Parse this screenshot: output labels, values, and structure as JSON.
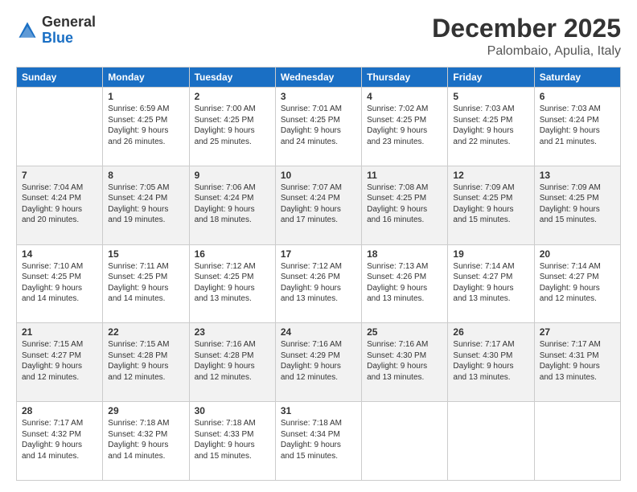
{
  "header": {
    "logo_general": "General",
    "logo_blue": "Blue",
    "month_title": "December 2025",
    "location": "Palombaio, Apulia, Italy"
  },
  "weekdays": [
    "Sunday",
    "Monday",
    "Tuesday",
    "Wednesday",
    "Thursday",
    "Friday",
    "Saturday"
  ],
  "weeks": [
    [
      {
        "day": "",
        "info": ""
      },
      {
        "day": "1",
        "info": "Sunrise: 6:59 AM\nSunset: 4:25 PM\nDaylight: 9 hours\nand 26 minutes."
      },
      {
        "day": "2",
        "info": "Sunrise: 7:00 AM\nSunset: 4:25 PM\nDaylight: 9 hours\nand 25 minutes."
      },
      {
        "day": "3",
        "info": "Sunrise: 7:01 AM\nSunset: 4:25 PM\nDaylight: 9 hours\nand 24 minutes."
      },
      {
        "day": "4",
        "info": "Sunrise: 7:02 AM\nSunset: 4:25 PM\nDaylight: 9 hours\nand 23 minutes."
      },
      {
        "day": "5",
        "info": "Sunrise: 7:03 AM\nSunset: 4:25 PM\nDaylight: 9 hours\nand 22 minutes."
      },
      {
        "day": "6",
        "info": "Sunrise: 7:03 AM\nSunset: 4:24 PM\nDaylight: 9 hours\nand 21 minutes."
      }
    ],
    [
      {
        "day": "7",
        "info": "Sunrise: 7:04 AM\nSunset: 4:24 PM\nDaylight: 9 hours\nand 20 minutes."
      },
      {
        "day": "8",
        "info": "Sunrise: 7:05 AM\nSunset: 4:24 PM\nDaylight: 9 hours\nand 19 minutes."
      },
      {
        "day": "9",
        "info": "Sunrise: 7:06 AM\nSunset: 4:24 PM\nDaylight: 9 hours\nand 18 minutes."
      },
      {
        "day": "10",
        "info": "Sunrise: 7:07 AM\nSunset: 4:24 PM\nDaylight: 9 hours\nand 17 minutes."
      },
      {
        "day": "11",
        "info": "Sunrise: 7:08 AM\nSunset: 4:25 PM\nDaylight: 9 hours\nand 16 minutes."
      },
      {
        "day": "12",
        "info": "Sunrise: 7:09 AM\nSunset: 4:25 PM\nDaylight: 9 hours\nand 15 minutes."
      },
      {
        "day": "13",
        "info": "Sunrise: 7:09 AM\nSunset: 4:25 PM\nDaylight: 9 hours\nand 15 minutes."
      }
    ],
    [
      {
        "day": "14",
        "info": "Sunrise: 7:10 AM\nSunset: 4:25 PM\nDaylight: 9 hours\nand 14 minutes."
      },
      {
        "day": "15",
        "info": "Sunrise: 7:11 AM\nSunset: 4:25 PM\nDaylight: 9 hours\nand 14 minutes."
      },
      {
        "day": "16",
        "info": "Sunrise: 7:12 AM\nSunset: 4:25 PM\nDaylight: 9 hours\nand 13 minutes."
      },
      {
        "day": "17",
        "info": "Sunrise: 7:12 AM\nSunset: 4:26 PM\nDaylight: 9 hours\nand 13 minutes."
      },
      {
        "day": "18",
        "info": "Sunrise: 7:13 AM\nSunset: 4:26 PM\nDaylight: 9 hours\nand 13 minutes."
      },
      {
        "day": "19",
        "info": "Sunrise: 7:14 AM\nSunset: 4:27 PM\nDaylight: 9 hours\nand 13 minutes."
      },
      {
        "day": "20",
        "info": "Sunrise: 7:14 AM\nSunset: 4:27 PM\nDaylight: 9 hours\nand 12 minutes."
      }
    ],
    [
      {
        "day": "21",
        "info": "Sunrise: 7:15 AM\nSunset: 4:27 PM\nDaylight: 9 hours\nand 12 minutes."
      },
      {
        "day": "22",
        "info": "Sunrise: 7:15 AM\nSunset: 4:28 PM\nDaylight: 9 hours\nand 12 minutes."
      },
      {
        "day": "23",
        "info": "Sunrise: 7:16 AM\nSunset: 4:28 PM\nDaylight: 9 hours\nand 12 minutes."
      },
      {
        "day": "24",
        "info": "Sunrise: 7:16 AM\nSunset: 4:29 PM\nDaylight: 9 hours\nand 12 minutes."
      },
      {
        "day": "25",
        "info": "Sunrise: 7:16 AM\nSunset: 4:30 PM\nDaylight: 9 hours\nand 13 minutes."
      },
      {
        "day": "26",
        "info": "Sunrise: 7:17 AM\nSunset: 4:30 PM\nDaylight: 9 hours\nand 13 minutes."
      },
      {
        "day": "27",
        "info": "Sunrise: 7:17 AM\nSunset: 4:31 PM\nDaylight: 9 hours\nand 13 minutes."
      }
    ],
    [
      {
        "day": "28",
        "info": "Sunrise: 7:17 AM\nSunset: 4:32 PM\nDaylight: 9 hours\nand 14 minutes."
      },
      {
        "day": "29",
        "info": "Sunrise: 7:18 AM\nSunset: 4:32 PM\nDaylight: 9 hours\nand 14 minutes."
      },
      {
        "day": "30",
        "info": "Sunrise: 7:18 AM\nSunset: 4:33 PM\nDaylight: 9 hours\nand 15 minutes."
      },
      {
        "day": "31",
        "info": "Sunrise: 7:18 AM\nSunset: 4:34 PM\nDaylight: 9 hours\nand 15 minutes."
      },
      {
        "day": "",
        "info": ""
      },
      {
        "day": "",
        "info": ""
      },
      {
        "day": "",
        "info": ""
      }
    ]
  ]
}
